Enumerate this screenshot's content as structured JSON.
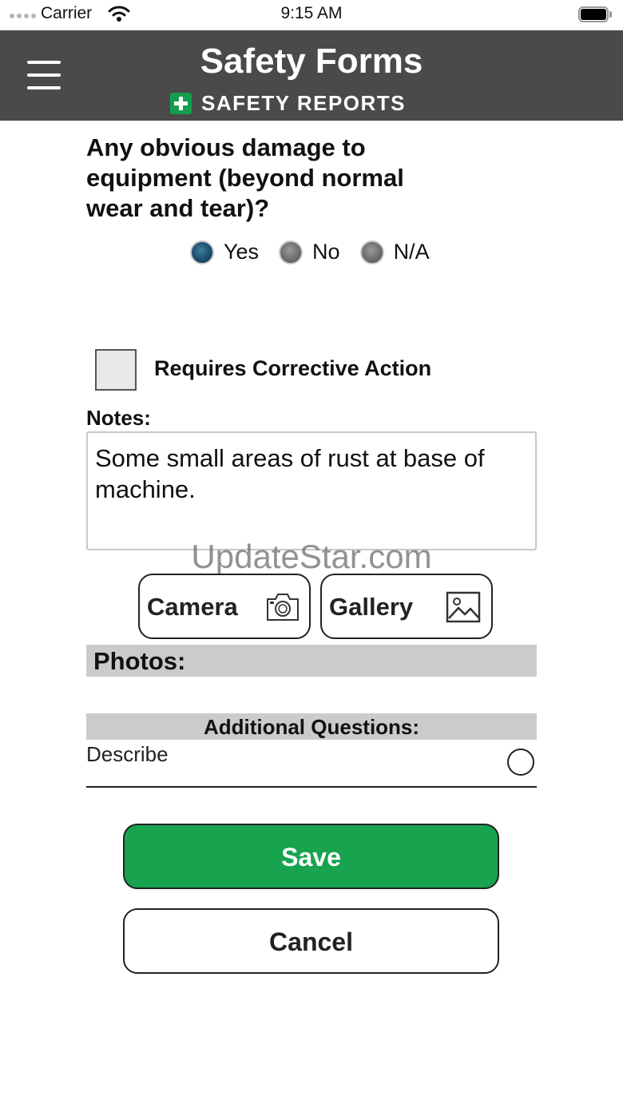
{
  "status_bar": {
    "carrier": "Carrier",
    "time": "9:15 AM",
    "battery_level": 1.0
  },
  "header": {
    "title": "Safety Forms",
    "brand": "SAFETY REPORTS",
    "menu_icon": "hamburger-menu-icon"
  },
  "question": {
    "text": "Any obvious damage to equipment (beyond normal wear and tear)?",
    "options": [
      "Yes",
      "No",
      "N/A"
    ],
    "selected": "Yes"
  },
  "corrective_action": {
    "label": "Requires Corrective Action",
    "checked": false
  },
  "notes": {
    "label": "Notes:",
    "value": "Some small areas of rust at base of machine."
  },
  "watermark": "UpdateStar.com",
  "buttons": {
    "camera": "Camera",
    "gallery": "Gallery",
    "save": "Save",
    "cancel": "Cancel"
  },
  "photos": {
    "label": "Photos:"
  },
  "additional_questions": {
    "header": "Additional Questions:",
    "items": [
      {
        "label": "Describe"
      }
    ]
  },
  "colors": {
    "header_bg": "#4a4a4a",
    "brand_green": "#139d4c",
    "save_green": "#18a34f",
    "section_gray": "#cbcbcb",
    "radio_selected": "#1d4e6a"
  }
}
